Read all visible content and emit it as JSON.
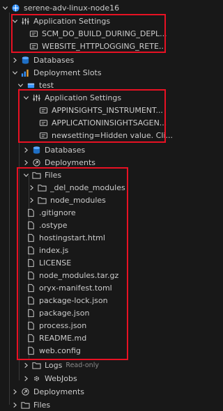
{
  "tree": {
    "app_name": "serene-adv-linux-node16",
    "app_settings_label": "Application Settings",
    "app_settings_items": [
      "SCM_DO_BUILD_DURING_DEPL...",
      "WEBSITE_HTTPLOGGING_RETE..."
    ],
    "databases_label": "Databases",
    "deployment_slots_label": "Deployment Slots",
    "slot_name": "test",
    "slot_app_settings_label": "Application Settings",
    "slot_app_settings_items": [
      "APPINSIGHTS_INSTRUMENT...",
      "APPLICATIONINSIGHTSAGEN...",
      "newsetting=Hidden value. Cli..."
    ],
    "slot_databases_label": "Databases",
    "slot_deployments_label": "Deployments",
    "files_label": "Files",
    "folders": [
      "_del_node_modules",
      "node_modules"
    ],
    "files": [
      ".gitignore",
      ".ostype",
      "hostingstart.html",
      "index.js",
      "LICENSE",
      "node_modules.tar.gz",
      "oryx-manifest.toml",
      "package-lock.json",
      "package.json",
      "process.json",
      "README.md",
      "web.config"
    ],
    "logs_label": "Logs",
    "logs_badge": "Read-only",
    "webjobs_label": "WebJobs",
    "deployments_label": "Deployments",
    "bottom_files_label": "Files"
  },
  "colors": {
    "highlight": "#e81123",
    "azure_blue": "#3794ff"
  }
}
